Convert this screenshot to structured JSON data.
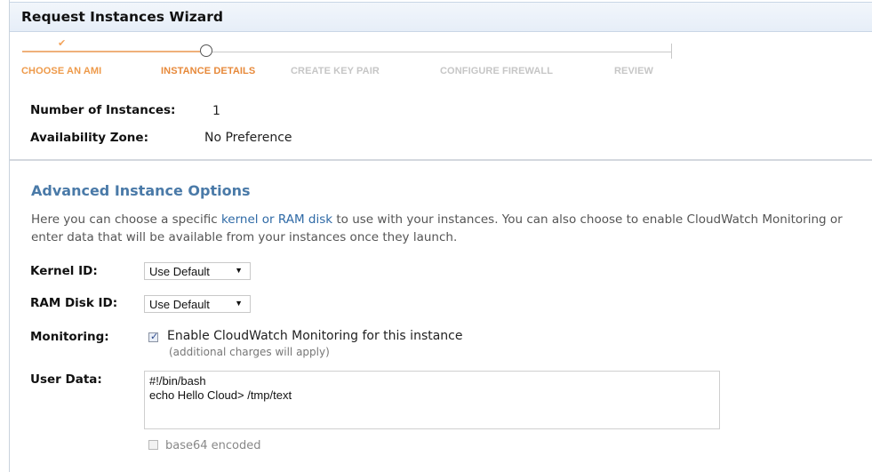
{
  "wizard": {
    "title": "Request Instances Wizard"
  },
  "steps": [
    {
      "label": "CHOOSE AN AMI",
      "state": "done"
    },
    {
      "label": "INSTANCE DETAILS",
      "state": "current"
    },
    {
      "label": "CREATE KEY PAIR",
      "state": "todo"
    },
    {
      "label": "CONFIGURE FIREWALL",
      "state": "todo"
    },
    {
      "label": "REVIEW",
      "state": "todo"
    }
  ],
  "details": {
    "instances_label": "Number of Instances:",
    "instances_value": "1",
    "zone_label": "Availability Zone:",
    "zone_value": "No Preference"
  },
  "advanced": {
    "title": "Advanced Instance Options",
    "desc_before": "Here you can choose a specific ",
    "desc_link": "kernel or RAM disk",
    "desc_after": " to use with your instances. You can also choose to enable CloudWatch Monitoring or enter data that will be available from your instances once they launch.",
    "kernel_label": "Kernel ID:",
    "kernel_value": "Use Default",
    "ramdisk_label": "RAM Disk ID:",
    "ramdisk_value": "Use Default",
    "monitoring_label": "Monitoring:",
    "monitoring_checked": true,
    "monitoring_text": "Enable CloudWatch Monitoring for this instance",
    "monitoring_note": "(additional charges will apply)",
    "userdata_label": "User Data:",
    "userdata_value": "#!/bin/bash\necho Hello Cloud> /tmp/text",
    "base64_checked": false,
    "base64_label": "base64 encoded"
  },
  "colors": {
    "accent_orange": "#ee9a4a",
    "section_blue": "#4a7aa8",
    "link_blue": "#2f6aa6"
  }
}
